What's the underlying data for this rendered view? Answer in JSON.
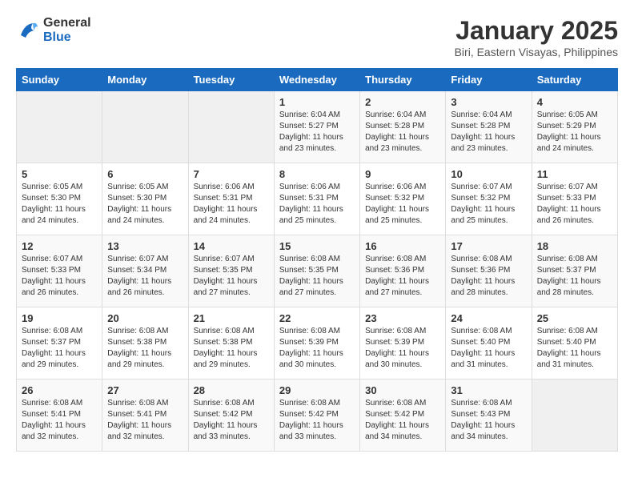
{
  "logo": {
    "line1": "General",
    "line2": "Blue"
  },
  "title": "January 2025",
  "subtitle": "Biri, Eastern Visayas, Philippines",
  "weekdays": [
    "Sunday",
    "Monday",
    "Tuesday",
    "Wednesday",
    "Thursday",
    "Friday",
    "Saturday"
  ],
  "weeks": [
    [
      {
        "day": "",
        "sunrise": "",
        "sunset": "",
        "daylight": ""
      },
      {
        "day": "",
        "sunrise": "",
        "sunset": "",
        "daylight": ""
      },
      {
        "day": "",
        "sunrise": "",
        "sunset": "",
        "daylight": ""
      },
      {
        "day": "1",
        "sunrise": "Sunrise: 6:04 AM",
        "sunset": "Sunset: 5:27 PM",
        "daylight": "Daylight: 11 hours and 23 minutes."
      },
      {
        "day": "2",
        "sunrise": "Sunrise: 6:04 AM",
        "sunset": "Sunset: 5:28 PM",
        "daylight": "Daylight: 11 hours and 23 minutes."
      },
      {
        "day": "3",
        "sunrise": "Sunrise: 6:04 AM",
        "sunset": "Sunset: 5:28 PM",
        "daylight": "Daylight: 11 hours and 23 minutes."
      },
      {
        "day": "4",
        "sunrise": "Sunrise: 6:05 AM",
        "sunset": "Sunset: 5:29 PM",
        "daylight": "Daylight: 11 hours and 24 minutes."
      }
    ],
    [
      {
        "day": "5",
        "sunrise": "Sunrise: 6:05 AM",
        "sunset": "Sunset: 5:30 PM",
        "daylight": "Daylight: 11 hours and 24 minutes."
      },
      {
        "day": "6",
        "sunrise": "Sunrise: 6:05 AM",
        "sunset": "Sunset: 5:30 PM",
        "daylight": "Daylight: 11 hours and 24 minutes."
      },
      {
        "day": "7",
        "sunrise": "Sunrise: 6:06 AM",
        "sunset": "Sunset: 5:31 PM",
        "daylight": "Daylight: 11 hours and 24 minutes."
      },
      {
        "day": "8",
        "sunrise": "Sunrise: 6:06 AM",
        "sunset": "Sunset: 5:31 PM",
        "daylight": "Daylight: 11 hours and 25 minutes."
      },
      {
        "day": "9",
        "sunrise": "Sunrise: 6:06 AM",
        "sunset": "Sunset: 5:32 PM",
        "daylight": "Daylight: 11 hours and 25 minutes."
      },
      {
        "day": "10",
        "sunrise": "Sunrise: 6:07 AM",
        "sunset": "Sunset: 5:32 PM",
        "daylight": "Daylight: 11 hours and 25 minutes."
      },
      {
        "day": "11",
        "sunrise": "Sunrise: 6:07 AM",
        "sunset": "Sunset: 5:33 PM",
        "daylight": "Daylight: 11 hours and 26 minutes."
      }
    ],
    [
      {
        "day": "12",
        "sunrise": "Sunrise: 6:07 AM",
        "sunset": "Sunset: 5:33 PM",
        "daylight": "Daylight: 11 hours and 26 minutes."
      },
      {
        "day": "13",
        "sunrise": "Sunrise: 6:07 AM",
        "sunset": "Sunset: 5:34 PM",
        "daylight": "Daylight: 11 hours and 26 minutes."
      },
      {
        "day": "14",
        "sunrise": "Sunrise: 6:07 AM",
        "sunset": "Sunset: 5:35 PM",
        "daylight": "Daylight: 11 hours and 27 minutes."
      },
      {
        "day": "15",
        "sunrise": "Sunrise: 6:08 AM",
        "sunset": "Sunset: 5:35 PM",
        "daylight": "Daylight: 11 hours and 27 minutes."
      },
      {
        "day": "16",
        "sunrise": "Sunrise: 6:08 AM",
        "sunset": "Sunset: 5:36 PM",
        "daylight": "Daylight: 11 hours and 27 minutes."
      },
      {
        "day": "17",
        "sunrise": "Sunrise: 6:08 AM",
        "sunset": "Sunset: 5:36 PM",
        "daylight": "Daylight: 11 hours and 28 minutes."
      },
      {
        "day": "18",
        "sunrise": "Sunrise: 6:08 AM",
        "sunset": "Sunset: 5:37 PM",
        "daylight": "Daylight: 11 hours and 28 minutes."
      }
    ],
    [
      {
        "day": "19",
        "sunrise": "Sunrise: 6:08 AM",
        "sunset": "Sunset: 5:37 PM",
        "daylight": "Daylight: 11 hours and 29 minutes."
      },
      {
        "day": "20",
        "sunrise": "Sunrise: 6:08 AM",
        "sunset": "Sunset: 5:38 PM",
        "daylight": "Daylight: 11 hours and 29 minutes."
      },
      {
        "day": "21",
        "sunrise": "Sunrise: 6:08 AM",
        "sunset": "Sunset: 5:38 PM",
        "daylight": "Daylight: 11 hours and 29 minutes."
      },
      {
        "day": "22",
        "sunrise": "Sunrise: 6:08 AM",
        "sunset": "Sunset: 5:39 PM",
        "daylight": "Daylight: 11 hours and 30 minutes."
      },
      {
        "day": "23",
        "sunrise": "Sunrise: 6:08 AM",
        "sunset": "Sunset: 5:39 PM",
        "daylight": "Daylight: 11 hours and 30 minutes."
      },
      {
        "day": "24",
        "sunrise": "Sunrise: 6:08 AM",
        "sunset": "Sunset: 5:40 PM",
        "daylight": "Daylight: 11 hours and 31 minutes."
      },
      {
        "day": "25",
        "sunrise": "Sunrise: 6:08 AM",
        "sunset": "Sunset: 5:40 PM",
        "daylight": "Daylight: 11 hours and 31 minutes."
      }
    ],
    [
      {
        "day": "26",
        "sunrise": "Sunrise: 6:08 AM",
        "sunset": "Sunset: 5:41 PM",
        "daylight": "Daylight: 11 hours and 32 minutes."
      },
      {
        "day": "27",
        "sunrise": "Sunrise: 6:08 AM",
        "sunset": "Sunset: 5:41 PM",
        "daylight": "Daylight: 11 hours and 32 minutes."
      },
      {
        "day": "28",
        "sunrise": "Sunrise: 6:08 AM",
        "sunset": "Sunset: 5:42 PM",
        "daylight": "Daylight: 11 hours and 33 minutes."
      },
      {
        "day": "29",
        "sunrise": "Sunrise: 6:08 AM",
        "sunset": "Sunset: 5:42 PM",
        "daylight": "Daylight: 11 hours and 33 minutes."
      },
      {
        "day": "30",
        "sunrise": "Sunrise: 6:08 AM",
        "sunset": "Sunset: 5:42 PM",
        "daylight": "Daylight: 11 hours and 34 minutes."
      },
      {
        "day": "31",
        "sunrise": "Sunrise: 6:08 AM",
        "sunset": "Sunset: 5:43 PM",
        "daylight": "Daylight: 11 hours and 34 minutes."
      },
      {
        "day": "",
        "sunrise": "",
        "sunset": "",
        "daylight": ""
      }
    ]
  ]
}
